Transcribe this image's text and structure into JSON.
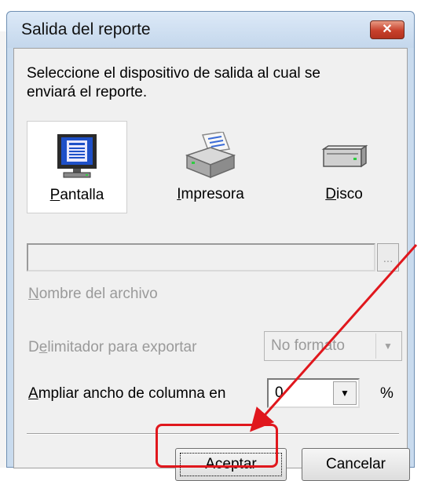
{
  "window": {
    "title": "Salida del reporte",
    "close_label": "✕"
  },
  "instructions": "Seleccione el dispositivo de salida al cual se enviará el reporte.",
  "devices": [
    {
      "label": "Pantalla",
      "mnemonic": "P",
      "rest": "antalla",
      "icon": "monitor-icon",
      "selected": true
    },
    {
      "label": "Impresora",
      "mnemonic": "I",
      "rest": "mpresora",
      "icon": "printer-icon",
      "selected": false
    },
    {
      "label": "Disco",
      "mnemonic": "D",
      "rest": "isco",
      "icon": "disk-drive-icon",
      "selected": false
    }
  ],
  "file": {
    "value": "",
    "browse_label": "...",
    "label": "Nombre del archivo"
  },
  "delimiter": {
    "label": "Delimitador para exportar",
    "value": "No formato"
  },
  "ampliar": {
    "label": "Ampliar ancho de columna en",
    "value": "0",
    "unit": "%"
  },
  "buttons": {
    "accept": "Aceptar",
    "cancel": "Cancelar"
  },
  "annotation": {
    "color": "#e0171d"
  }
}
